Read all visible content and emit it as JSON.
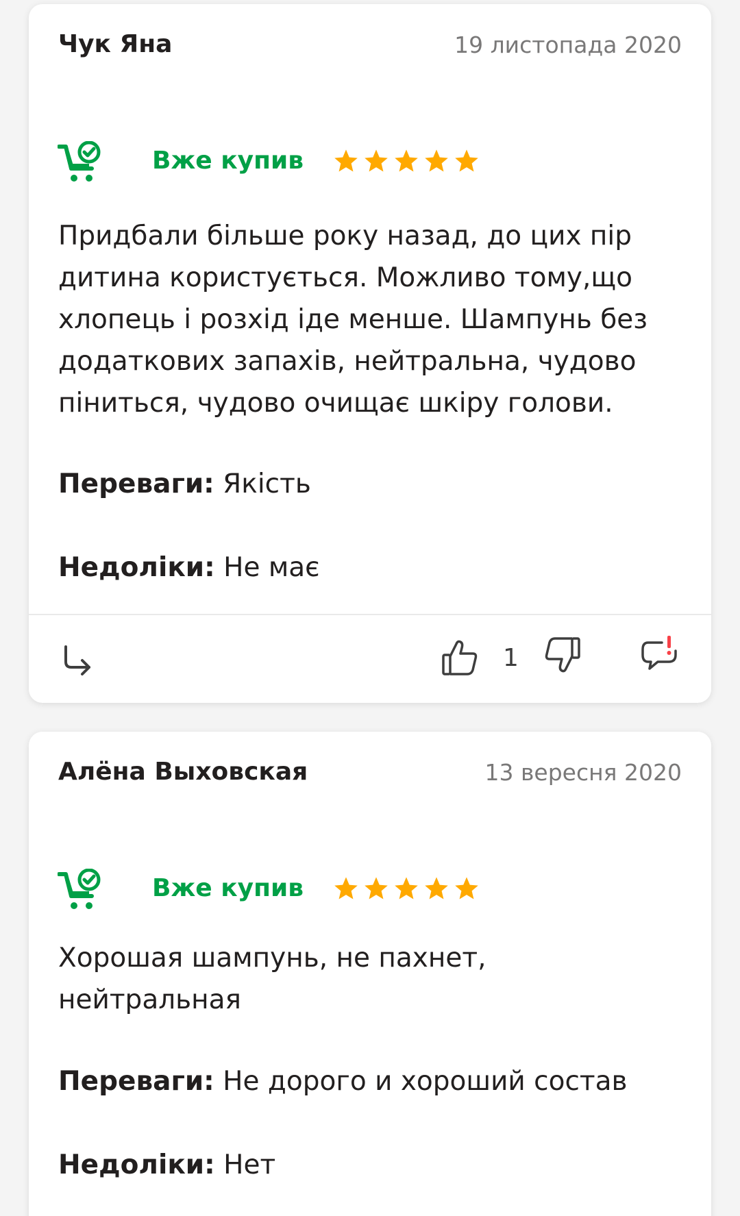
{
  "reviews": [
    {
      "author": "Чук Яна",
      "date": "19 листопада 2020",
      "buyer_label": "Вже купив",
      "rating": 5,
      "text": "Придбали більше року назад, до цих пір дитина користується. Можливо тому,що хлопець і розхід іде менше. Шампунь без додаткових запахів, нейтральна, чудово піниться, чудово очищає шкіру голови.",
      "pros_label": "Переваги:",
      "pros": "Якість",
      "cons_label": "Недоліки:",
      "cons": "Не має",
      "likes": "1"
    },
    {
      "author": "Алёна Выховская",
      "date": "13 вересня 2020",
      "buyer_label": "Вже купив",
      "rating": 5,
      "text": "Хорошая шампунь, не пахнет, нейтральная",
      "pros_label": "Переваги:",
      "pros": "Не дорого и хороший состав",
      "cons_label": "Недоліки:",
      "cons": "Нет"
    }
  ],
  "colors": {
    "buyer_green": "#00a046",
    "star_orange": "#ffa900",
    "text": "#221f1f",
    "date_gray": "#797878",
    "complain_red": "#f84147"
  },
  "icons": {
    "cart": "cart-check-icon",
    "star": "star-icon",
    "reply": "reply-arrow-icon",
    "like": "thumbs-up-icon",
    "dislike": "thumbs-down-icon",
    "complain": "complaint-bubble-icon"
  }
}
